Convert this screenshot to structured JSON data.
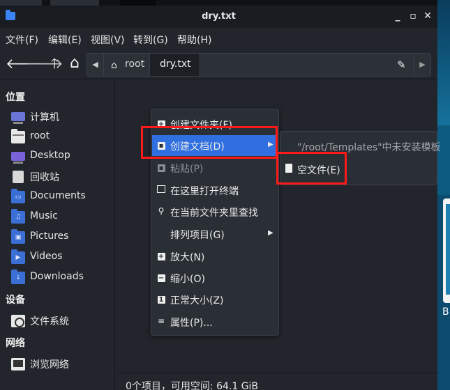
{
  "window": {
    "title": "dry.txt",
    "min_glyph": "_",
    "max_glyph": "▫",
    "close_glyph": "✕"
  },
  "menubar": {
    "items": [
      "文件(F)",
      "编辑(E)",
      "视图(V)",
      "转到(G)",
      "帮助(H)"
    ]
  },
  "toolbar": {
    "back_glyph": "🡐",
    "forward_glyph": "🡒",
    "up_glyph": "🡑",
    "home_glyph": "⌂",
    "path_left_glyph": "◀",
    "path_right_glyph": "▶",
    "edit_glyph": "✎",
    "crumbs": [
      {
        "label": "root",
        "icon": "home-icon"
      },
      {
        "label": "dry.txt"
      }
    ]
  },
  "sidebar": {
    "sections": [
      {
        "heading": "位置"
      },
      {
        "heading": "设备"
      },
      {
        "heading": "网络"
      }
    ],
    "places": [
      {
        "label": "计算机",
        "icon": "computer-icon"
      },
      {
        "label": "root",
        "icon": "home-folder-icon"
      },
      {
        "label": "Desktop",
        "icon": "desktop-folder-icon"
      },
      {
        "label": "回收站",
        "icon": "trash-icon"
      },
      {
        "label": "Documents",
        "icon": "documents-folder-icon",
        "glyph": "▭"
      },
      {
        "label": "Music",
        "icon": "music-folder-icon",
        "glyph": "♫"
      },
      {
        "label": "Pictures",
        "icon": "pictures-folder-icon",
        "glyph": "▣"
      },
      {
        "label": "Videos",
        "icon": "videos-folder-icon",
        "glyph": "▶"
      },
      {
        "label": "Downloads",
        "icon": "downloads-folder-icon",
        "glyph": "↓"
      }
    ],
    "devices": [
      {
        "label": "文件系统",
        "icon": "drive-icon"
      }
    ],
    "network": [
      {
        "label": "浏览网络",
        "icon": "network-icon"
      }
    ]
  },
  "context_menu": {
    "items": [
      {
        "label": "创建文件夹(F)",
        "icon": "new-folder-icon",
        "glyph": "+"
      },
      {
        "label": "创建文档(D)",
        "icon": "new-document-icon",
        "glyph": "▪",
        "submenu": true,
        "highlighted": true
      },
      {
        "label": "粘贴(P)",
        "icon": "paste-icon",
        "glyph": "▪",
        "disabled": true
      },
      {
        "label": "在这里打开终端",
        "icon": "terminal-icon",
        "glyph": "▭"
      },
      {
        "label": "在当前文件夹里查找",
        "icon": "search-icon",
        "glyph": "⚲"
      },
      {
        "label": "排列项目(G)",
        "icon": "",
        "glyph": "",
        "submenu": true
      },
      {
        "label": "放大(N)",
        "icon": "zoom-in-icon",
        "glyph": "+"
      },
      {
        "label": "缩小(O)",
        "icon": "zoom-out-icon",
        "glyph": "−"
      },
      {
        "label": "正常大小(Z)",
        "icon": "zoom-normal-icon",
        "glyph": "1"
      },
      {
        "label": "属性(P)...",
        "icon": "properties-icon",
        "glyph": "≡"
      }
    ],
    "submenu_arrow": "▶"
  },
  "submenu": {
    "hint": "\"/root/Templates\"中未安装模板",
    "empty_file_label": "空文件(E)"
  },
  "statusbar": {
    "text": "0个项目，可用空间: 64.1 GiB"
  },
  "desktop": {
    "letter": "B"
  },
  "colors": {
    "highlight": "#2f6fe0",
    "annotation_red": "#ff1a1a",
    "window_bg": "#22262c",
    "menu_bg": "#2a2e35"
  }
}
